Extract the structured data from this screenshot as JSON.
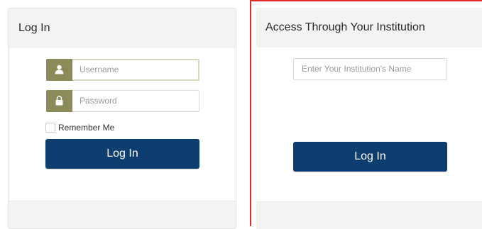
{
  "login_panel": {
    "title": "Log In",
    "username_placeholder": "Username",
    "password_placeholder": "Password",
    "remember_label": "Remember Me",
    "login_button": "Log In",
    "user_icon": "user-icon",
    "lock_icon": "lock-icon"
  },
  "institution_panel": {
    "title": "Access Through Your Institution",
    "institution_placeholder": "Enter Your Institution's Name",
    "login_button": "Log In"
  },
  "colors": {
    "primary_button": "#0e3d70",
    "addon_olive": "#8b8a59",
    "highlight_border": "#e42b2b",
    "panel_header_bg": "#f3f3f3"
  }
}
